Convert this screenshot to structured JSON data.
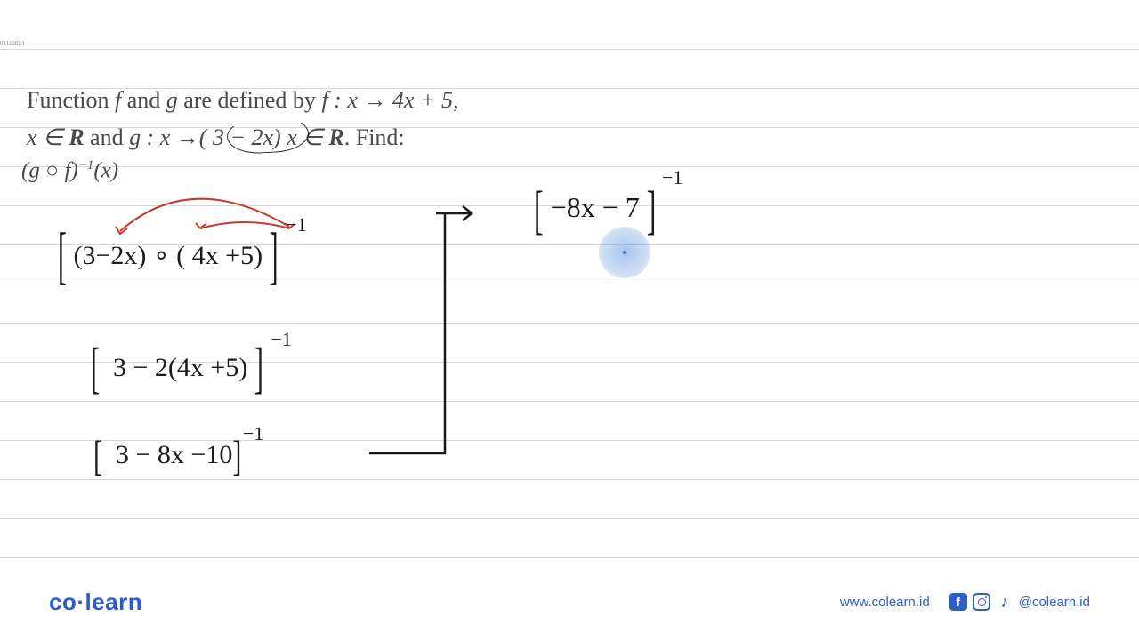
{
  "smallMark": "01112024",
  "question": {
    "line1_pre": "Function ",
    "f": "f",
    "and": " and ",
    "g": "g",
    "defined": " are defined by ",
    "fdef": "f : x → 4x + 5,",
    "line2_pre": "x ∈ ",
    "R1": "R",
    "and2": " and ",
    "gdef_pre": "g : x →",
    "gdef_body": "( 3 − 2x)",
    "gdef_post": " x ∈ ",
    "R2": "R",
    "find": ". Find:"
  },
  "gof": {
    "open": "(",
    "g": "g",
    "circ": " ○ ",
    "f": "f",
    "close": ")",
    "sup": "−1",
    "x": "(x)"
  },
  "steps": {
    "s1": "(3−2x) ∘ ( 4x +5)",
    "s1exp": "−1",
    "s2": "3 − 2(4x +5)",
    "s2exp": "−1",
    "s3": "3 − 8x  −10",
    "s3exp": "−1",
    "s4": "−8x − 7",
    "s4exp": "−1"
  },
  "footer": {
    "logo_co": "co",
    "logo_dot": "·",
    "logo_learn": "learn",
    "url": "www.colearn.id",
    "handle": "@colearn.id",
    "fb": "f",
    "tt": "♪"
  }
}
